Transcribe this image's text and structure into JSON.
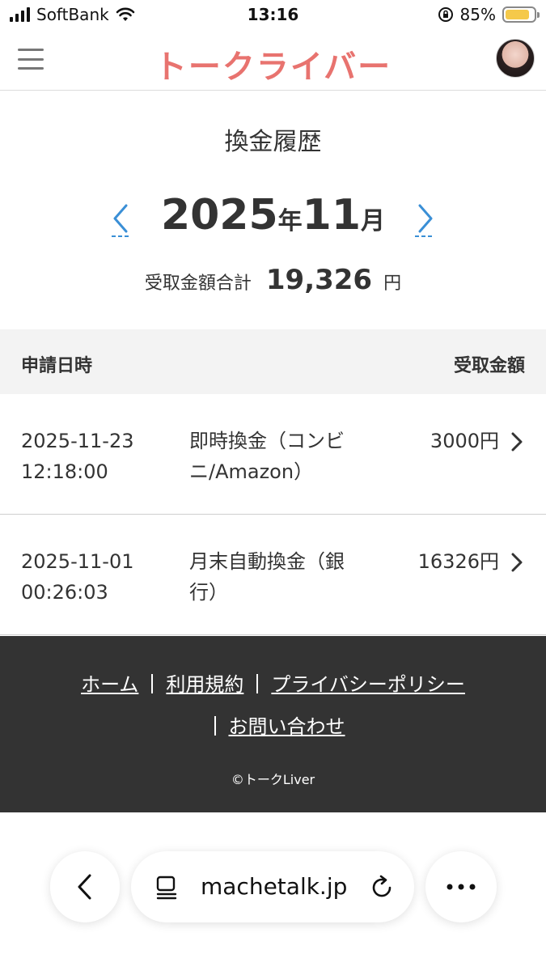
{
  "status": {
    "carrier": "SoftBank",
    "time": "13:16",
    "battery_percent": "85%",
    "battery_level": 0.85
  },
  "header": {
    "logo": "トークライバー",
    "icons": {
      "menu": "hamburger-menu-icon",
      "avatar": "user-avatar"
    }
  },
  "summary": {
    "title": "換金履歴",
    "year": "2025",
    "year_suffix": "年",
    "month": "11",
    "month_suffix": "月",
    "total_label": "受取金額合計",
    "total_value": "19,326",
    "total_unit": "円"
  },
  "table": {
    "header_left": "申請日時",
    "header_right": "受取金額",
    "rows": [
      {
        "date": "2025-11-23",
        "time": "12:18:00",
        "type": "即時換金（コンビニ/Amazon）",
        "amount": "3000円"
      },
      {
        "date": "2025-11-01",
        "time": "00:26:03",
        "type": "月末自動換金（銀行）",
        "amount": "16326円"
      }
    ]
  },
  "footer": {
    "links": [
      "ホーム",
      "利用規約",
      "プライバシーポリシー",
      "お問い合わせ"
    ],
    "copyright": "©トークLiver"
  },
  "browser": {
    "url": "machetalk.jp"
  },
  "colors": {
    "brand": "#e8736f",
    "nav_arrow": "#3a8fd6",
    "footer_bg": "#333333",
    "table_header_bg": "#f3f3f3"
  }
}
